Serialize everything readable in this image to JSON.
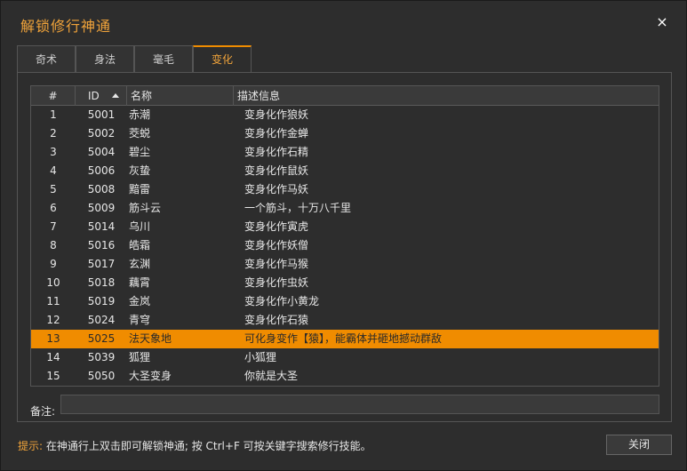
{
  "window": {
    "title": "解锁修行神通",
    "close_icon": "×"
  },
  "tabs": [
    {
      "label": "奇术"
    },
    {
      "label": "身法"
    },
    {
      "label": "毫毛"
    },
    {
      "label": "变化"
    }
  ],
  "table": {
    "headers": {
      "idx": "#",
      "id": "ID",
      "name": "名称",
      "desc": "描述信息"
    },
    "rows": [
      {
        "idx": "1",
        "id": "5001",
        "name": "赤潮",
        "desc": "变身化作狼妖"
      },
      {
        "idx": "2",
        "id": "5002",
        "name": "茭蜕",
        "desc": "变身化作金蝉"
      },
      {
        "idx": "3",
        "id": "5004",
        "name": "碧尘",
        "desc": "变身化作石精"
      },
      {
        "idx": "4",
        "id": "5006",
        "name": "灰蛰",
        "desc": "变身化作鼠妖"
      },
      {
        "idx": "5",
        "id": "5008",
        "name": "黯雷",
        "desc": "变身化作马妖"
      },
      {
        "idx": "6",
        "id": "5009",
        "name": "筋斗云",
        "desc": "一个筋斗，十万八千里"
      },
      {
        "idx": "7",
        "id": "5014",
        "name": "乌川",
        "desc": "变身化作寅虎"
      },
      {
        "idx": "8",
        "id": "5016",
        "name": "皓霜",
        "desc": "变身化作妖僧"
      },
      {
        "idx": "9",
        "id": "5017",
        "name": "玄渊",
        "desc": "变身化作马猴"
      },
      {
        "idx": "10",
        "id": "5018",
        "name": "藕霄",
        "desc": "变身化作虫妖"
      },
      {
        "idx": "11",
        "id": "5019",
        "name": "金岚",
        "desc": "变身化作小黄龙"
      },
      {
        "idx": "12",
        "id": "5024",
        "name": "青穹",
        "desc": "变身化作石猿"
      },
      {
        "idx": "13",
        "id": "5025",
        "name": "法天象地",
        "desc": "可化身变作【猿】，能霸体并砸地撼动群敌"
      },
      {
        "idx": "14",
        "id": "5039",
        "name": "狐狸",
        "desc": "小狐狸"
      },
      {
        "idx": "15",
        "id": "5050",
        "name": "大圣变身",
        "desc": "你就是大圣"
      }
    ]
  },
  "note": {
    "label": "备注:",
    "value": ""
  },
  "hint": {
    "label": "提示:",
    "text": " 在神通行上双击即可解锁神通; 按 Ctrl+F 可按关键字搜索修行技能。"
  },
  "footer": {
    "close_label": "关闭"
  },
  "colors": {
    "accent": "#f08c00",
    "title": "#f0a33a",
    "background": "#2d2d2d"
  }
}
